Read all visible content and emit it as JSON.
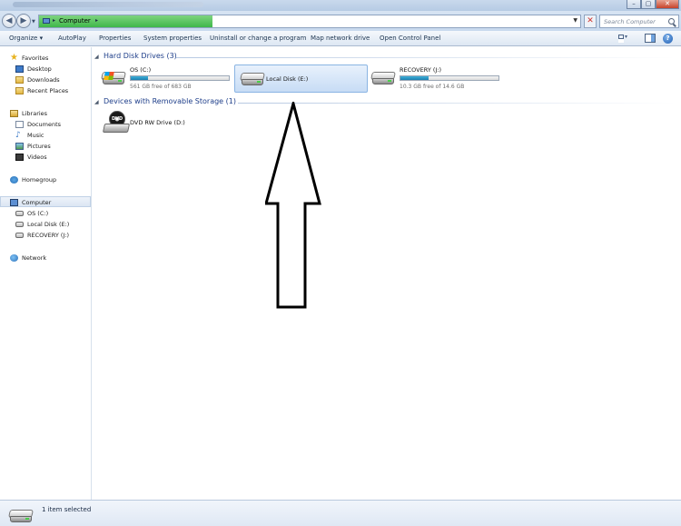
{
  "window": {
    "buttons": {
      "minimize": "–",
      "maximize": "▢",
      "close": "✕"
    }
  },
  "address": {
    "back_glyph": "◀",
    "forward_glyph": "▶",
    "location": "Computer",
    "progress_percent": 32,
    "search_placeholder": "Search Computer",
    "stop_glyph": "✕"
  },
  "toolbar": {
    "organize": "Organize ▾",
    "autoplay": "AutoPlay",
    "properties": "Properties",
    "system_properties": "System properties",
    "uninstall": "Uninstall or change a program",
    "map_drive": "Map network drive",
    "control_panel": "Open Control Panel",
    "help": "?"
  },
  "nav": {
    "favorites": "Favorites",
    "desktop": "Desktop",
    "downloads": "Downloads",
    "recent": "Recent Places",
    "libraries": "Libraries",
    "documents": "Documents",
    "music": "Music",
    "pictures": "Pictures",
    "videos": "Videos",
    "homegroup": "Homegroup",
    "computer": "Computer",
    "os_c": "OS (C:)",
    "local_e": "Local Disk (E:)",
    "recovery_j": "RECOVERY (J:)",
    "network": "Network",
    "star_glyph": "★",
    "music_glyph": "♪"
  },
  "content": {
    "hdd_header": "Hard Disk Drives (3)",
    "removable_header": "Devices with Removable Storage (1)",
    "drives": [
      {
        "name": "OS (C:)",
        "free": "561 GB free of 683 GB",
        "used_fraction": 0.18
      },
      {
        "name": "Local Disk (E:)"
      },
      {
        "name": "RECOVERY (J:)",
        "free": "10.3 GB free of 14.6 GB",
        "used_fraction": 0.29
      }
    ],
    "dvd": {
      "name": "DVD RW Drive (D:)",
      "label": "DVD"
    },
    "chevron_glyph": "◢"
  },
  "status": {
    "text": "1 item selected"
  },
  "colors": {
    "capacity_fill": "#1d7fb0",
    "group_header": "#1e3e8a",
    "selection": "#c7dcf5",
    "address_progress": "#3fb74a"
  }
}
